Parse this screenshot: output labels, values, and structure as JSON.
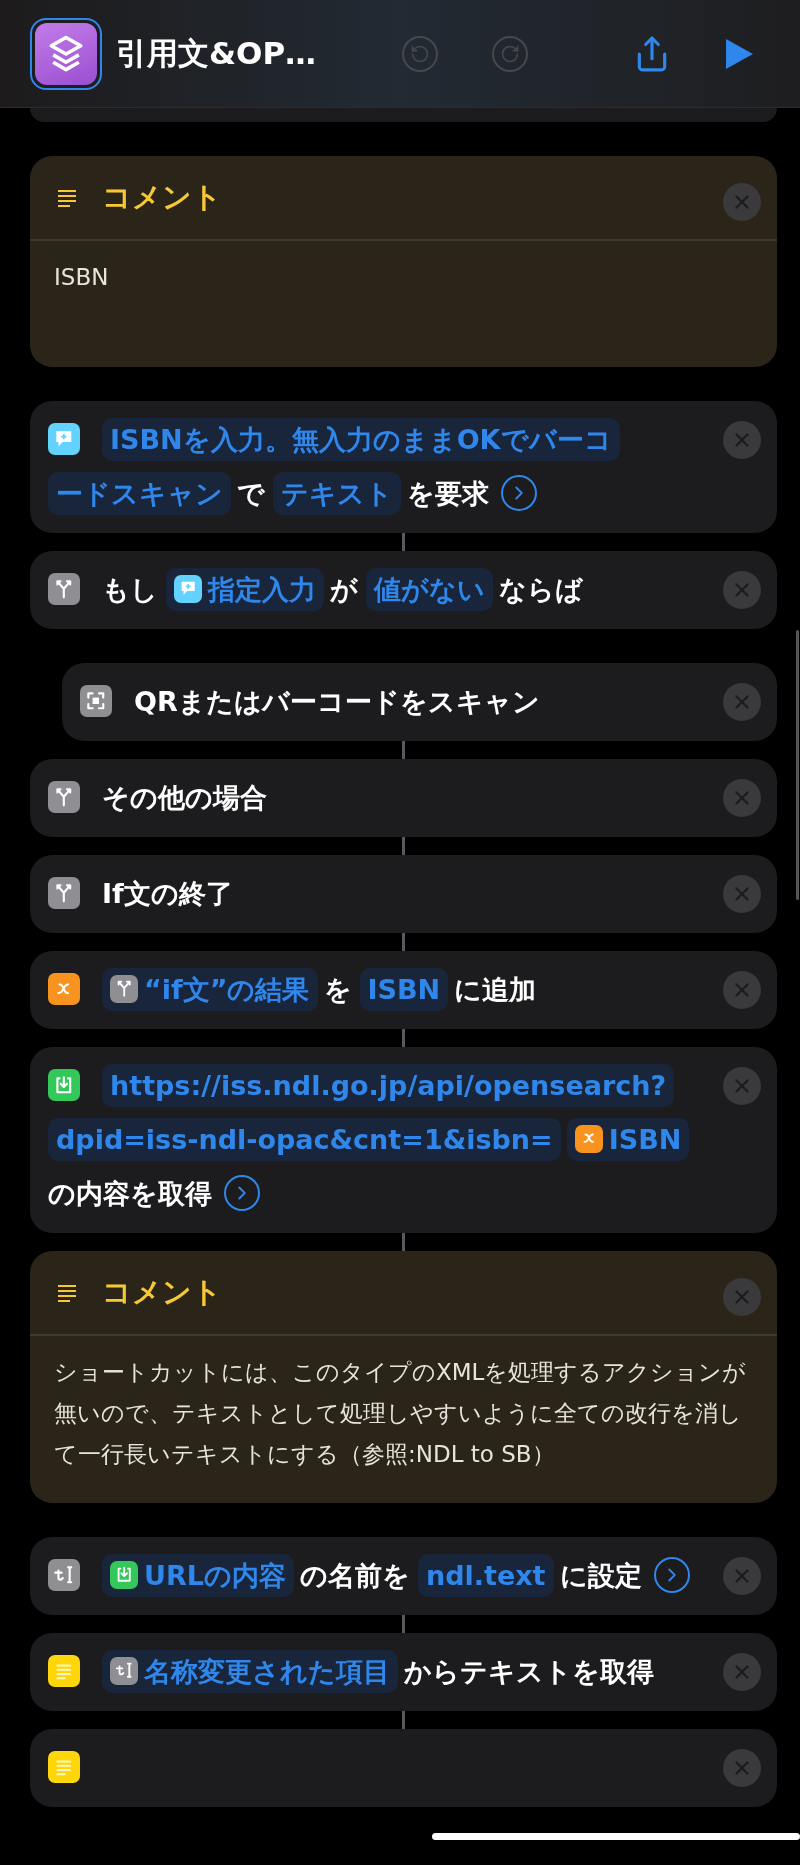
{
  "header": {
    "title": "引用文&OP…"
  },
  "blocks": [
    {
      "kind": "cut_card"
    },
    {
      "kind": "comment",
      "connector": false,
      "title": "コメント",
      "body": "ISBN"
    },
    {
      "kind": "ask",
      "connector": false,
      "indented": false,
      "parts": [
        {
          "kind": "token",
          "text": "ISBNを入力。無入力のままOKでバーコ"
        },
        {
          "kind": "token",
          "text": "ードスキャン"
        },
        {
          "kind": "text",
          "text": "で"
        },
        {
          "kind": "token",
          "text": "テキスト"
        },
        {
          "kind": "text",
          "text": "を要求"
        },
        {
          "kind": "more"
        }
      ]
    },
    {
      "kind": "if",
      "connector": true,
      "indented": false,
      "parts": [
        {
          "kind": "text",
          "text": "もし"
        },
        {
          "kind": "ask_token",
          "text": "指定入力"
        },
        {
          "kind": "text",
          "text": "が"
        },
        {
          "kind": "token",
          "text": "値がない"
        },
        {
          "kind": "text",
          "text": "ならば"
        }
      ]
    },
    {
      "kind": "scan",
      "connector": false,
      "indented": true,
      "parts": [
        {
          "kind": "text",
          "text": "QRまたはバーコードをスキャン"
        }
      ]
    },
    {
      "kind": "if",
      "connector": true,
      "indented": false,
      "parts": [
        {
          "kind": "text",
          "text": "その他の場合"
        }
      ]
    },
    {
      "kind": "if",
      "connector": true,
      "indented": false,
      "parts": [
        {
          "kind": "text",
          "text": "If文の終了"
        }
      ]
    },
    {
      "kind": "variable",
      "connector": true,
      "indented": false,
      "parts": [
        {
          "kind": "if_token",
          "text": "“if文”の結果"
        },
        {
          "kind": "text",
          "text": "を"
        },
        {
          "kind": "token",
          "text": "ISBN"
        },
        {
          "kind": "text",
          "text": "に追加"
        }
      ]
    },
    {
      "kind": "download",
      "connector": true,
      "indented": false,
      "parts": [
        {
          "kind": "token",
          "text": "https://iss.ndl.go.jp/api/opensearch?"
        },
        {
          "kind": "token",
          "text": "dpid=iss-ndl-opac&cnt=1&isbn="
        },
        {
          "kind": "variable_token",
          "text": "ISBN"
        },
        {
          "kind": "text",
          "text": "の内容を取得"
        },
        {
          "kind": "more"
        }
      ]
    },
    {
      "kind": "comment",
      "connector": true,
      "title": "コメント",
      "body": "ショートカットには、このタイプのXMLを処理するアクションが無いので、テキストとして処理しやすいように全ての改行を消して一行長いテキストにする（参照:NDL to SB）"
    },
    {
      "kind": "rename",
      "connector": false,
      "indented": false,
      "parts": [
        {
          "kind": "download_token",
          "text": "URLの内容"
        },
        {
          "kind": "text",
          "text": "の名前を"
        },
        {
          "kind": "token",
          "text": "ndl.text"
        },
        {
          "kind": "text",
          "text": "に設定"
        },
        {
          "kind": "more"
        }
      ]
    },
    {
      "kind": "text",
      "connector": true,
      "indented": false,
      "parts": [
        {
          "kind": "rename_token",
          "text": "名称変更された項目"
        },
        {
          "kind": "text",
          "text": "からテキストを取得"
        }
      ]
    },
    {
      "kind": "text",
      "connector": true,
      "indented": false
    }
  ]
}
